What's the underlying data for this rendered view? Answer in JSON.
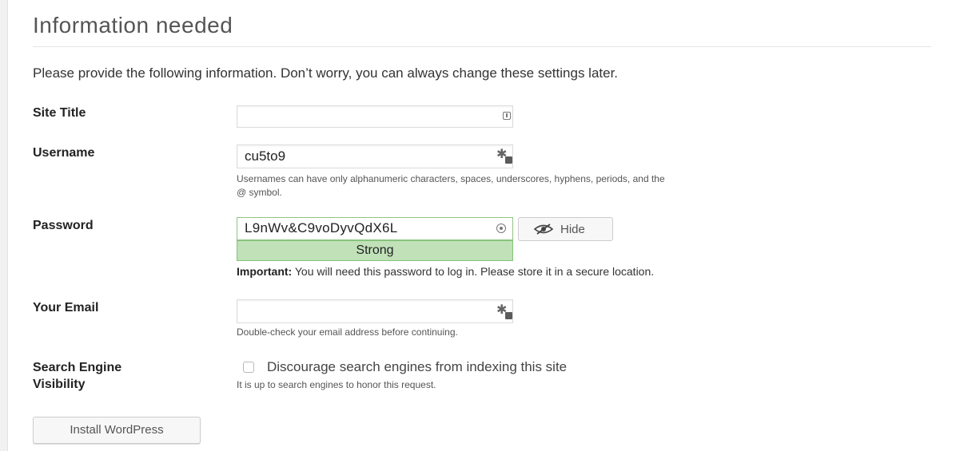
{
  "page": {
    "title": "Information needed",
    "intro": "Please provide the following information. Don’t worry, you can always change these settings later."
  },
  "form": {
    "site_title": {
      "label": "Site Title",
      "value": ""
    },
    "username": {
      "label": "Username",
      "value": "cu5to9",
      "help_line1": "Usernames can have only alphanumeric characters, spaces, underscores, hyphens, periods, and the",
      "help_line2": "@ symbol."
    },
    "password": {
      "label": "Password",
      "value": "L9nWv&C9voDyvQdX6L",
      "strength": "Strong",
      "hide_label": "Hide",
      "important_prefix": "Important:",
      "important_text": " You will need this password to log in. Please store it in a secure location."
    },
    "email": {
      "label": "Your Email",
      "value": "",
      "help": "Double-check your email address before continuing."
    },
    "search_visibility": {
      "label_line1": "Search Engine",
      "label_line2": "Visibility",
      "checkbox_label": "Discourage search engines from indexing this site",
      "checked": false,
      "help": "It is up to search engines to honor this request."
    }
  },
  "actions": {
    "install_label": "Install WordPress"
  },
  "icons": {
    "site_title_field": "autofill-icon",
    "username_field": "password-manager-key-icon",
    "password_field": "password-generate-icon",
    "hide_button": "eye-slash-icon",
    "email_field": "password-manager-key-icon"
  },
  "colors": {
    "strength_bg": "#c1e1b9",
    "strength_border": "#84c27a"
  }
}
